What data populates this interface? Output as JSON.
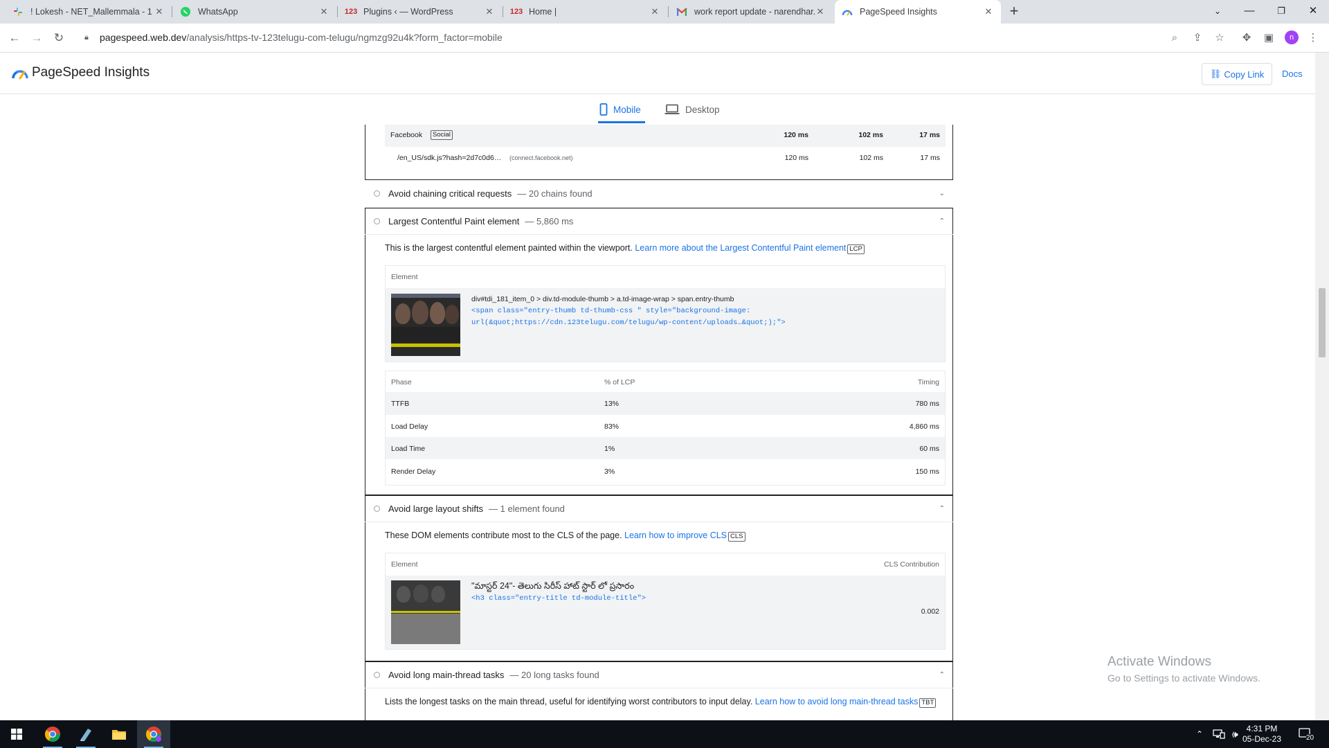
{
  "browser": {
    "tabs": [
      {
        "label": "! Lokesh - NET_Mallemmala - 1 ...",
        "icon": "slack-icon"
      },
      {
        "label": "WhatsApp",
        "icon": "whatsapp-icon"
      },
      {
        "label": "Plugins ‹ — WordPress",
        "icon": "123telugu-icon"
      },
      {
        "label": "Home |",
        "icon": "123telugu-icon"
      },
      {
        "label": "work report update - narendhar...",
        "icon": "gmail-icon"
      },
      {
        "label": "PageSpeed Insights",
        "icon": "pagespeed-icon"
      }
    ],
    "url_host": "pagespeed.web.dev",
    "url_path": "/analysis/https-tv-123telugu-com-telugu/ngmzg92u4k?form_factor=mobile",
    "profile_initial": "n"
  },
  "header": {
    "title": "PageSpeed Insights",
    "copy_link": "Copy Link",
    "docs": "Docs"
  },
  "form_tabs": {
    "mobile": "Mobile",
    "desktop": "Desktop"
  },
  "third_party": {
    "entity": "Facebook",
    "entity_tag": "Social",
    "entity_values": [
      "120 ms",
      "102 ms",
      "17 ms"
    ],
    "url": "/en_US/sdk.js?hash=2d7c0d6…",
    "url_domain": "(connect.facebook.net)",
    "url_values": [
      "120 ms",
      "102 ms",
      "17 ms"
    ]
  },
  "audits": {
    "chaining": {
      "title": "Avoid chaining critical requests",
      "display": "— 20 chains found"
    },
    "lcp": {
      "title": "Largest Contentful Paint element",
      "display": "— 5,860 ms",
      "desc": "This is the largest contentful element painted within the viewport.",
      "link": "Learn more about the Largest Contentful Paint element",
      "tag": "LCP",
      "element_header": "Element",
      "selector": "div#tdi_181_item_0 > div.td-module-thumb > a.td-image-wrap > span.entry-thumb",
      "snippet_1": "<span class=\"entry-thumb td-thumb-css \" style=\"background-image:",
      "snippet_2": "url(&quot;https://cdn.123telugu.com/telugu/wp-content/uploads…&quot;);\">",
      "phase_headers": {
        "phase": "Phase",
        "pct": "% of LCP",
        "timing": "Timing"
      },
      "phases": [
        {
          "phase": "TTFB",
          "pct": "13%",
          "timing": "780 ms"
        },
        {
          "phase": "Load Delay",
          "pct": "83%",
          "timing": "4,860 ms"
        },
        {
          "phase": "Load Time",
          "pct": "1%",
          "timing": "60 ms"
        },
        {
          "phase": "Render Delay",
          "pct": "3%",
          "timing": "150 ms"
        }
      ]
    },
    "cls": {
      "title": "Avoid large layout shifts",
      "display": "— 1 element found",
      "desc": "These DOM elements contribute most to the CLS of the page.",
      "link": "Learn how to improve CLS",
      "tag": "CLS",
      "element_header": "Element",
      "contrib_header": "CLS Contribution",
      "node_text": "\"మాస్టర్ 24\"- తెలుగు సిరీస్ హాట్ స్టార్ లో ప్రసారం",
      "snippet": "<h3 class=\"entry-title td-module-title\">",
      "value": "0.002"
    },
    "long_tasks": {
      "title": "Avoid long main-thread tasks",
      "display": "— 20 long tasks found",
      "desc": "Lists the longest tasks on the main thread, useful for identifying worst contributors to input delay.",
      "link": "Learn how to avoid long main-thread tasks",
      "tag": "TBT"
    }
  },
  "watermark": {
    "line1": "Activate Windows",
    "line2": "Go to Settings to activate Windows."
  },
  "taskbar": {
    "time": "4:31 PM",
    "date": "05-Dec-23",
    "notifications": "20"
  }
}
